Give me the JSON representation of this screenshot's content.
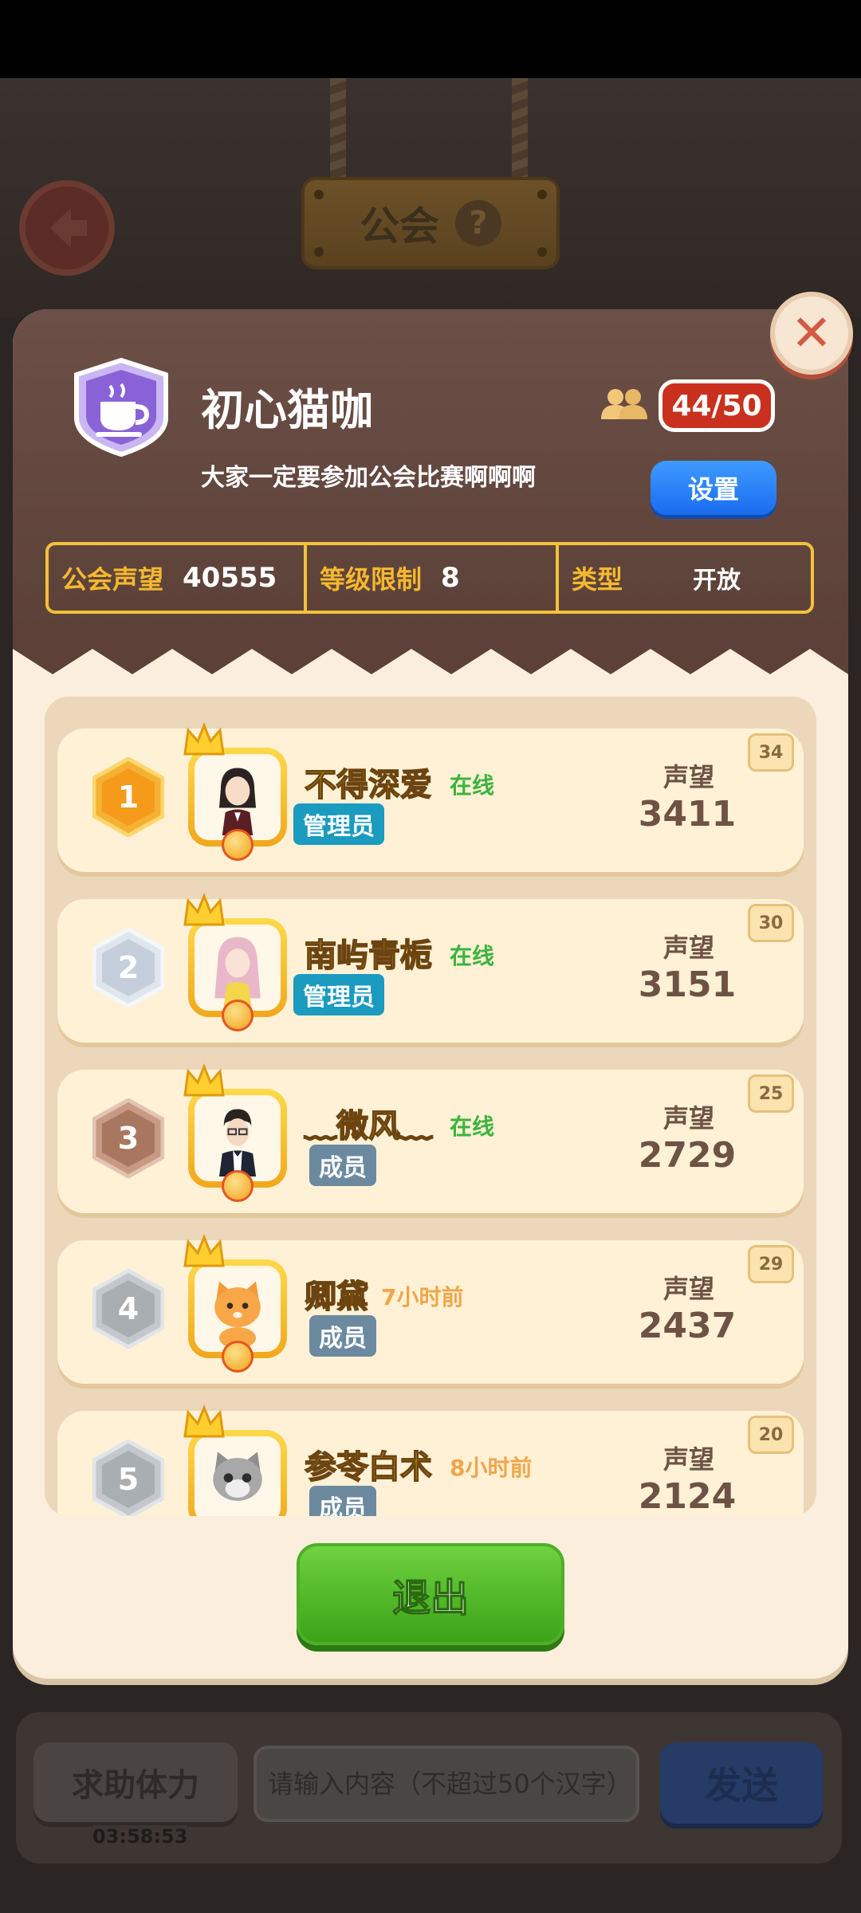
{
  "header": {
    "title": "公会"
  },
  "guild": {
    "name": "初心猫咖",
    "motto": "大家一定要参加公会比赛啊啊啊",
    "member_count": "44/50",
    "settings_label": "设置"
  },
  "stats": [
    {
      "label": "公会声望",
      "value": "40555"
    },
    {
      "label": "等级限制",
      "value": "8"
    },
    {
      "label": "类型",
      "value": "开放"
    }
  ],
  "members": [
    {
      "rank": "1",
      "name": "不得深爱",
      "status": "在线",
      "role": "管理员",
      "rep_label": "声望",
      "rep": "3411",
      "level": "34"
    },
    {
      "rank": "2",
      "name": "南屿青栀",
      "status": "在线",
      "role": "管理员",
      "rep_label": "声望",
      "rep": "3151",
      "level": "30"
    },
    {
      "rank": "3",
      "name": "﹏微风﹏",
      "status": "在线",
      "role": "成员",
      "rep_label": "声望",
      "rep": "2729",
      "level": "25"
    },
    {
      "rank": "4",
      "name": "卿黛",
      "status": "7小时前",
      "role": "成员",
      "rep_label": "声望",
      "rep": "2437",
      "level": "29"
    },
    {
      "rank": "5",
      "name": "参苓白术",
      "status": "8小时前",
      "role": "成员",
      "rep_label": "声望",
      "rep": "2124",
      "level": "20"
    }
  ],
  "quit_label": "退出",
  "chat": {
    "help_label": "求助体力",
    "timer": "03:58:53",
    "placeholder": "请输入内容（不超过50个汉字）",
    "send_label": "发送"
  },
  "colors": {
    "gold_medal": "#f7a92a",
    "silver_medal": "#c9d3de",
    "bronze_medal": "#b5826a",
    "grey_medal": "#aeb3b7",
    "online": "#3cb43c",
    "offline": "#f0a64a",
    "admin_badge": "#1a9bbf",
    "member_badge": "#6b8aa0"
  }
}
